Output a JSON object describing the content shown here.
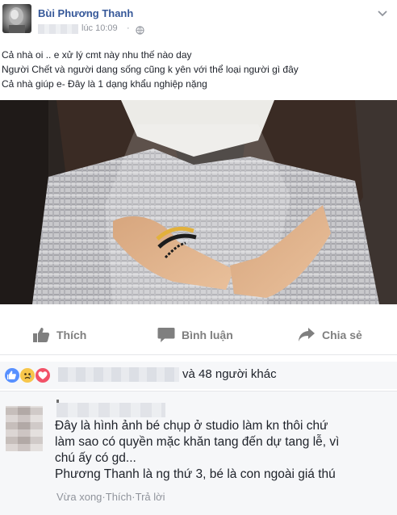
{
  "post": {
    "author": "Bùi Phương Thanh",
    "timestamp": "lúc 10:09",
    "meta_separator": "·",
    "lines": [
      "Cả nhà oi .. e xử lý cmt này nhu thế nào day",
      "Người Chết và người dang sống cũng k yên với thể loại người gì đây",
      "Cả nhà giúp e- Đây là 1 dạng khẩu nghiệp nặng"
    ]
  },
  "actions": {
    "like_label": "Thích",
    "comment_label": "Bình luận",
    "share_label": "Chia sẻ"
  },
  "reactions": {
    "others_text": "và 48 người khác",
    "types": [
      "like-icon",
      "sad-icon",
      "love-icon"
    ],
    "colors": {
      "like": "#5890ff",
      "sad": "#f7c64a",
      "love": "#f25268"
    }
  },
  "comment": {
    "lines": [
      "Đây là hình ảnh bé chụp ở studio làm kn thôi chứ",
      "làm sao có quyền mặc khăn tang đến dự tang lễ, vì",
      "chú ấy có gd...",
      "Phương Thanh là ng thứ 3, bé là con ngoài giá thú"
    ],
    "meta": {
      "time": "Vừa xong",
      "sep": " · ",
      "like": "Thích",
      "reply": "Trả lời"
    }
  },
  "colors": {
    "link": "#365899",
    "muted": "#90949c",
    "action_gray": "#7f7f7f"
  }
}
